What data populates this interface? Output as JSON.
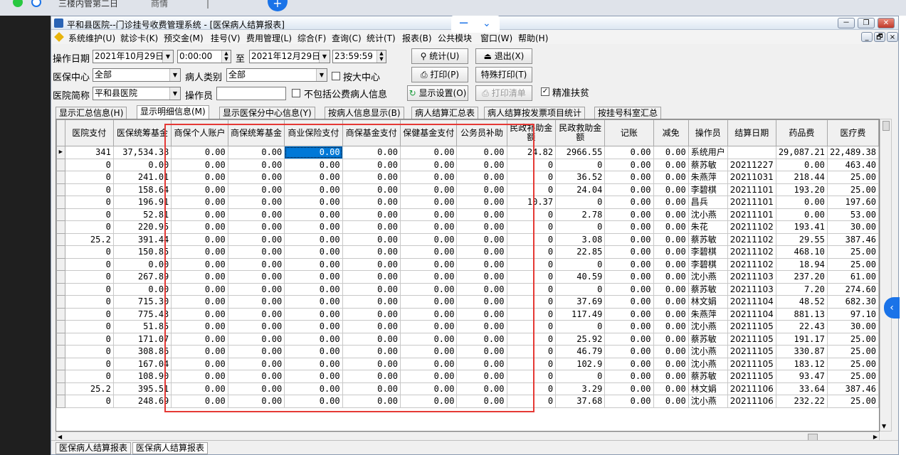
{
  "browser": {
    "tab1": "三楼内管第二日",
    "tab2": "商情",
    "new_tab_symbol": "+"
  },
  "window": {
    "title": "平和县医院--门诊挂号收费管理系统 - [医保病人结算报表]",
    "min": "－",
    "restore": "❐",
    "close": "✕",
    "child_min": "_",
    "child_restore": "🗗",
    "child_close": "×"
  },
  "menu": [
    "系统维护(U)",
    "就诊卡(K)",
    "预交金(M)",
    "挂号(V)",
    "费用管理(L)",
    "综合(F)",
    "查询(C)",
    "统计(T)",
    "报表(B)",
    "公共模块",
    "窗口(W)",
    "帮助(H)"
  ],
  "filters": {
    "date_label": "操作日期",
    "date_from": "2021年10月29日",
    "time_from": "0:00:00",
    "to_label": "至",
    "date_to": "2021年12月29日",
    "time_to": "23:59:59",
    "center_label": "医保中心",
    "center_value": "全部",
    "patient_type_label": "病人类别",
    "patient_type_value": "全部",
    "by_center_label": "按大中心",
    "hospital_label": "医院简称",
    "hospital_value": "平和县医院",
    "operator_label": "操作员",
    "operator_value": "",
    "exclude_label": "不包括公费病人信息",
    "precise_label": "精准扶贫"
  },
  "buttons": {
    "stat": "统计(U)",
    "exit": "退出(X)",
    "print": "打印(P)",
    "special_print": "特殊打印(T)",
    "display_settings": "显示设置(O)",
    "print_list": "打印清单"
  },
  "tabs": [
    "显示汇总信息(H)",
    "显示明细信息(M)",
    "显示医保分中心信息(Y)",
    "按病人信息显示(B)",
    "病人结算汇总表",
    "病人结算按发票项目统计",
    "按挂号科室汇总"
  ],
  "active_tab": 1,
  "table": {
    "headers": [
      "医院支付",
      "医保统筹基金",
      "商保个人账户",
      "商保统筹基金",
      "商业保险支付",
      "商保基金支付",
      "保健基金支付",
      "公务员补助",
      "民政补助金额",
      "民政救助金额",
      "记账",
      "减免",
      "操作员",
      "结算日期",
      "药品费",
      "医疗费"
    ],
    "rows": [
      [
        "341",
        "37,534.38",
        "0.00",
        "0.00",
        "0.00",
        "0.00",
        "0.00",
        "0.00",
        "24.82",
        "2966.55",
        "0.00",
        "0.00",
        "系统用户",
        "",
        "29,087.21",
        "22,489.38"
      ],
      [
        "0",
        "0.00",
        "0.00",
        "0.00",
        "0.00",
        "0.00",
        "0.00",
        "0.00",
        "0",
        "0",
        "0.00",
        "0.00",
        "蔡苏敏",
        "20211227",
        "0.00",
        "463.40"
      ],
      [
        "0",
        "241.01",
        "0.00",
        "0.00",
        "0.00",
        "0.00",
        "0.00",
        "0.00",
        "0",
        "36.52",
        "0.00",
        "0.00",
        "朱燕萍",
        "20211031",
        "218.44",
        "25.00"
      ],
      [
        "0",
        "158.64",
        "0.00",
        "0.00",
        "0.00",
        "0.00",
        "0.00",
        "0.00",
        "0",
        "24.04",
        "0.00",
        "0.00",
        "李碧棋",
        "20211101",
        "193.20",
        "25.00"
      ],
      [
        "0",
        "196.91",
        "0.00",
        "0.00",
        "0.00",
        "0.00",
        "0.00",
        "0.00",
        "10.37",
        "0",
        "0.00",
        "0.00",
        "昌兵",
        "20211101",
        "0.00",
        "197.60"
      ],
      [
        "0",
        "52.81",
        "0.00",
        "0.00",
        "0.00",
        "0.00",
        "0.00",
        "0.00",
        "0",
        "2.78",
        "0.00",
        "0.00",
        "沈小燕",
        "20211101",
        "0.00",
        "53.00"
      ],
      [
        "0",
        "220.95",
        "0.00",
        "0.00",
        "0.00",
        "0.00",
        "0.00",
        "0.00",
        "0",
        "0",
        "0.00",
        "0.00",
        "朱花",
        "20211102",
        "193.41",
        "30.00"
      ],
      [
        "25.2",
        "391.44",
        "0.00",
        "0.00",
        "0.00",
        "0.00",
        "0.00",
        "0.00",
        "0",
        "3.08",
        "0.00",
        "0.00",
        "蔡苏敏",
        "20211102",
        "29.55",
        "387.46"
      ],
      [
        "0",
        "150.85",
        "0.00",
        "0.00",
        "0.00",
        "0.00",
        "0.00",
        "0.00",
        "0",
        "22.85",
        "0.00",
        "0.00",
        "李碧棋",
        "20211102",
        "468.10",
        "25.00"
      ],
      [
        "0",
        "0.00",
        "0.00",
        "0.00",
        "0.00",
        "0.00",
        "0.00",
        "0.00",
        "0",
        "0",
        "0.00",
        "0.00",
        "李碧棋",
        "20211102",
        "18.94",
        "25.00"
      ],
      [
        "0",
        "267.89",
        "0.00",
        "0.00",
        "0.00",
        "0.00",
        "0.00",
        "0.00",
        "0",
        "40.59",
        "0.00",
        "0.00",
        "沈小燕",
        "20211103",
        "237.20",
        "61.00"
      ],
      [
        "0",
        "0.00",
        "0.00",
        "0.00",
        "0.00",
        "0.00",
        "0.00",
        "0.00",
        "0",
        "0",
        "0.00",
        "0.00",
        "蔡苏敏",
        "20211103",
        "7.20",
        "274.60"
      ],
      [
        "0",
        "715.30",
        "0.00",
        "0.00",
        "0.00",
        "0.00",
        "0.00",
        "0.00",
        "0",
        "37.69",
        "0.00",
        "0.00",
        "林文娟",
        "20211104",
        "48.52",
        "682.30"
      ],
      [
        "0",
        "775.43",
        "0.00",
        "0.00",
        "0.00",
        "0.00",
        "0.00",
        "0.00",
        "0",
        "117.49",
        "0.00",
        "0.00",
        "朱燕萍",
        "20211104",
        "881.13",
        "97.10"
      ],
      [
        "0",
        "51.85",
        "0.00",
        "0.00",
        "0.00",
        "0.00",
        "0.00",
        "0.00",
        "0",
        "0",
        "0.00",
        "0.00",
        "沈小燕",
        "20211105",
        "22.43",
        "30.00"
      ],
      [
        "0",
        "171.07",
        "0.00",
        "0.00",
        "0.00",
        "0.00",
        "0.00",
        "0.00",
        "0",
        "25.92",
        "0.00",
        "0.00",
        "蔡苏敏",
        "20211105",
        "191.17",
        "25.00"
      ],
      [
        "0",
        "308.86",
        "0.00",
        "0.00",
        "0.00",
        "0.00",
        "0.00",
        "0.00",
        "0",
        "46.79",
        "0.00",
        "0.00",
        "沈小燕",
        "20211105",
        "330.87",
        "25.00"
      ],
      [
        "0",
        "167.04",
        "0.00",
        "0.00",
        "0.00",
        "0.00",
        "0.00",
        "0.00",
        "0",
        "102.9",
        "0.00",
        "0.00",
        "沈小燕",
        "20211105",
        "183.12",
        "25.00"
      ],
      [
        "0",
        "108.90",
        "0.00",
        "0.00",
        "0.00",
        "0.00",
        "0.00",
        "0.00",
        "0",
        "0",
        "0.00",
        "0.00",
        "蔡苏敏",
        "20211105",
        "93.47",
        "25.00"
      ],
      [
        "25.2",
        "395.51",
        "0.00",
        "0.00",
        "0.00",
        "0.00",
        "0.00",
        "0.00",
        "0",
        "3.29",
        "0.00",
        "0.00",
        "林文娟",
        "20211106",
        "33.64",
        "387.46"
      ],
      [
        "0",
        "248.69",
        "0.00",
        "0.00",
        "0.00",
        "0.00",
        "0.00",
        "0.00",
        "0",
        "37.68",
        "0.00",
        "0.00",
        "沈小燕",
        "20211106",
        "232.22",
        "25.00"
      ]
    ]
  },
  "status_tabs": [
    "医保病人结算报表",
    "医保病人结算报表"
  ],
  "colors": {
    "highlight_box": "#e53935",
    "selection": "#0078d7",
    "browser_accent": "#1a73e8"
  }
}
